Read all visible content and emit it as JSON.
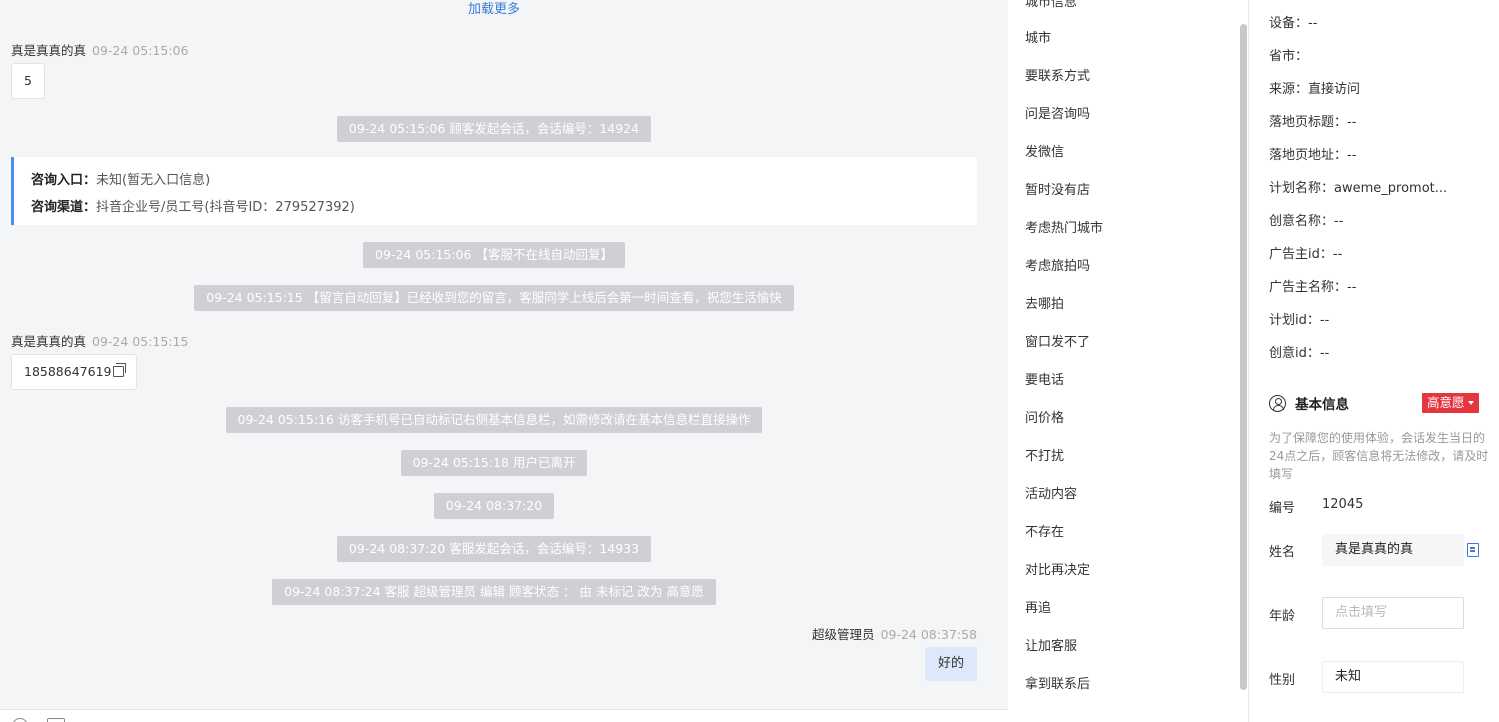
{
  "chat": {
    "load_more": "加载更多",
    "messages": [
      {
        "sender": "真是真真的真",
        "time": "09-24 05:15:06",
        "text": "5"
      },
      {
        "sender": "真是真真的真",
        "time": "09-24 05:15:15",
        "text": "18588647619"
      }
    ],
    "system": [
      "09-24 05:15:06 顾客发起会话，会话编号：14924",
      "09-24 05:15:06 【客服不在线自动回复】",
      "09-24 05:15:15 【留言自动回复】已经收到您的留言，客服同学上线后会第一时间查看，祝您生活愉快",
      "09-24 05:15:16 访客手机号已自动标记右侧基本信息栏，如需修改请在基本信息栏直接操作",
      "09-24 05:15:18 用户已离开",
      "09-24 08:37:20",
      "09-24 08:37:20 客服发起会话，会话编号：14933",
      "09-24 08:37:24 客服 超级管理员 编辑 顾客状态 ： 由 未标记 改为 高意愿"
    ],
    "entry": {
      "label1": "咨询入口：",
      "value1": "未知(暂无入口信息)",
      "label2": "咨询渠道：",
      "value2": "抖音企业号/员工号(抖音号ID：279527392)"
    },
    "agent": {
      "name": "超级管理员",
      "time": "09-24 08:37:58",
      "text": "好的"
    }
  },
  "tags": [
    "城市",
    "要联系方式",
    "问是咨询吗",
    "发微信",
    "暂时没有店",
    "考虑热门城市",
    "考虑旅拍吗",
    "去哪拍",
    "窗口发不了",
    "要电话",
    "问价格",
    "不打扰",
    "活动内容",
    "不存在",
    "对比再决定",
    "再追",
    "让加客服",
    "拿到联系后"
  ],
  "info": {
    "visit": [
      {
        "label": "设备：",
        "value": "--"
      },
      {
        "label": "省市：",
        "value": ""
      },
      {
        "label": "来源：",
        "value": "直接访问"
      },
      {
        "label": "落地页标题：",
        "value": "--"
      },
      {
        "label": "落地页地址：",
        "value": "--"
      },
      {
        "label": "计划名称：",
        "value": "aweme_promot..."
      },
      {
        "label": "创意名称：",
        "value": "--"
      },
      {
        "label": "广告主id：",
        "value": "--"
      },
      {
        "label": "广告主名称：",
        "value": "--"
      },
      {
        "label": "计划id：",
        "value": "--"
      },
      {
        "label": "创意id：",
        "value": "--"
      }
    ],
    "basic_title": "基本信息",
    "intent": "高意愿",
    "notice": "为了保障您的使用体验，会话发生当日的24点之后，顾客信息将无法修改，请及时填写",
    "id_label": "编号",
    "id_value": "12045",
    "name_label": "姓名",
    "name_value": "真是真真的真",
    "age_label": "年龄",
    "age_placeholder": "点击填写",
    "gender_label": "性别",
    "gender_value": "未知"
  }
}
